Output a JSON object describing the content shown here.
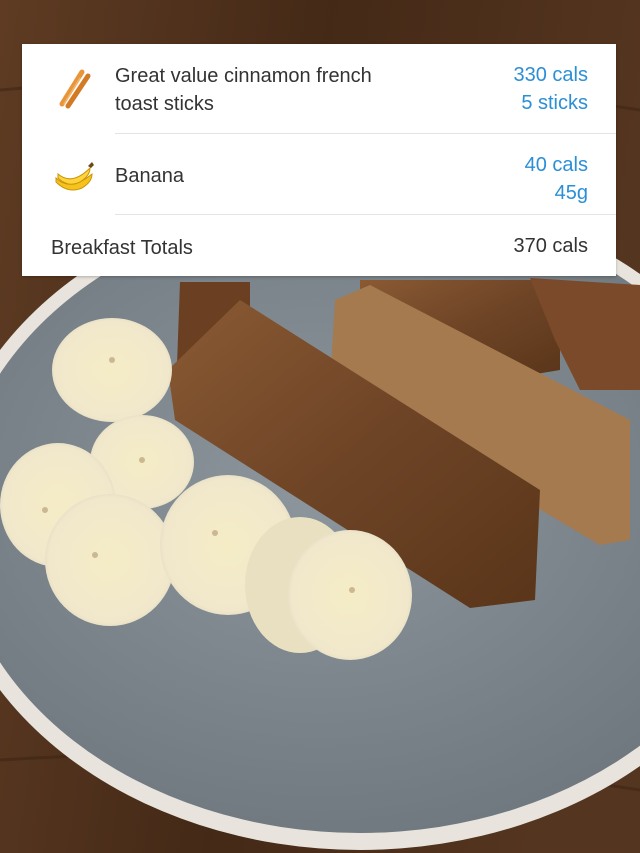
{
  "log": {
    "items": [
      {
        "icon": "cinnamon-stick-icon",
        "name_line1": "Great value cinnamon french",
        "name_line2": "toast sticks",
        "calories": "330 cals",
        "quantity": "5 sticks"
      },
      {
        "icon": "banana-icon",
        "name_line1": "Banana",
        "calories": "40 cals",
        "quantity": "45g"
      }
    ],
    "totals": {
      "label": "Breakfast Totals",
      "calories": "370 cals"
    }
  },
  "colors": {
    "calorie_accent": "#2b8fd6",
    "text": "#333333",
    "card_bg": "#ffffff"
  }
}
